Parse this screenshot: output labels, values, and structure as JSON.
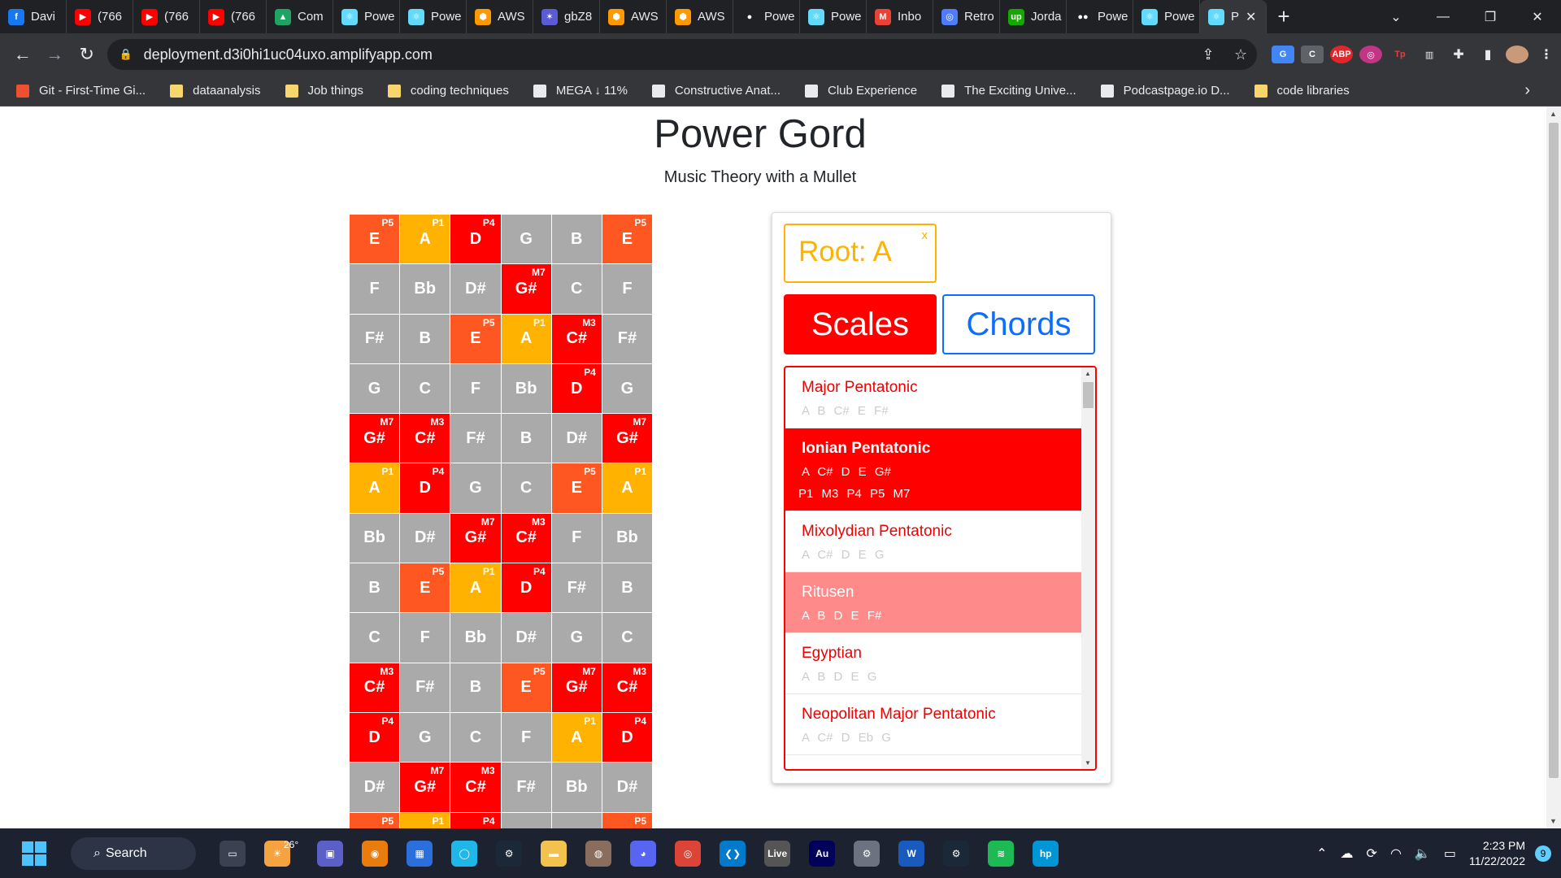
{
  "browser": {
    "tabs": [
      {
        "label": "Davi",
        "icon": "facebook-icon",
        "color": "#1877f2",
        "glyph": "f"
      },
      {
        "label": "(766",
        "icon": "youtube-icon",
        "color": "#ff0000",
        "glyph": "▶"
      },
      {
        "label": "(766",
        "icon": "youtube-icon",
        "color": "#ff0000",
        "glyph": "▶"
      },
      {
        "label": "(766",
        "icon": "youtube-icon",
        "color": "#ff0000",
        "glyph": "▶"
      },
      {
        "label": "Com",
        "icon": "google-drive-icon",
        "color": "#1fa463",
        "glyph": "▲"
      },
      {
        "label": "Powe",
        "icon": "react-icon",
        "color": "#61dafb",
        "glyph": "⚛"
      },
      {
        "label": "Powe",
        "icon": "react-icon",
        "color": "#61dafb",
        "glyph": "⚛"
      },
      {
        "label": "AWS",
        "icon": "aws-icon",
        "color": "#ff9900",
        "glyph": "⬢"
      },
      {
        "label": "gbZ8",
        "icon": "graph-icon",
        "color": "#5b5bd6",
        "glyph": "✶"
      },
      {
        "label": "AWS",
        "icon": "aws-icon",
        "color": "#ff9900",
        "glyph": "⬢"
      },
      {
        "label": "AWS",
        "icon": "aws-icon",
        "color": "#ff9900",
        "glyph": "⬢"
      },
      {
        "label": "Powe",
        "icon": "github-icon",
        "color": "#202124",
        "glyph": "●"
      },
      {
        "label": "Powe",
        "icon": "react-icon",
        "color": "#61dafb",
        "glyph": "⚛"
      },
      {
        "label": "Inbo",
        "icon": "gmail-icon",
        "color": "#ea4335",
        "glyph": "M"
      },
      {
        "label": "Retro",
        "icon": "globe-icon",
        "color": "#4f7cff",
        "glyph": "◎"
      },
      {
        "label": "Jorda",
        "icon": "upwork-icon",
        "color": "#14a800",
        "glyph": "up"
      },
      {
        "label": "Powe",
        "icon": "medium-icon",
        "color": "#202124",
        "glyph": "●●"
      },
      {
        "label": "Powe",
        "icon": "react-icon",
        "color": "#61dafb",
        "glyph": "⚛"
      },
      {
        "label": "P",
        "icon": "react-icon",
        "color": "#61dafb",
        "glyph": "⚛",
        "active": true
      }
    ],
    "url": "deployment.d3i0hi1uc04uxo.amplifyapp.com",
    "bookmarks": [
      {
        "label": "Git - First-Time Gi...",
        "color": "#f05032"
      },
      {
        "label": "dataanalysis",
        "color": "#f9d56e"
      },
      {
        "label": "Job things",
        "color": "#f9d56e"
      },
      {
        "label": "coding techniques",
        "color": "#f9d56e"
      },
      {
        "label": "MEGA ↓ 11%",
        "color": "#e8eaed"
      },
      {
        "label": "Constructive Anat...",
        "color": "#e8eaed"
      },
      {
        "label": "Club Experience",
        "color": "#e8eaed"
      },
      {
        "label": "The Exciting Unive...",
        "color": "#e8eaed"
      },
      {
        "label": "Podcastpage.io D...",
        "color": "#e8eaed"
      },
      {
        "label": "code libraries",
        "color": "#f9d56e"
      }
    ]
  },
  "app": {
    "title": "Power Gord",
    "subtitle": "Music Theory with a Mullet",
    "colors": {
      "root": "#ffb300",
      "fifth": "#ff5722",
      "scale_tone": "#ff0000",
      "other": "#aaaaaa",
      "accent": "#0d6efd"
    },
    "fretboard": [
      [
        {
          "n": "E",
          "i": "P5"
        },
        {
          "n": "A",
          "i": "P1"
        },
        {
          "n": "D",
          "i": "P4"
        },
        {
          "n": "G",
          "i": ""
        },
        {
          "n": "B",
          "i": ""
        },
        {
          "n": "E",
          "i": "P5"
        }
      ],
      [
        {
          "n": "F",
          "i": ""
        },
        {
          "n": "Bb",
          "i": ""
        },
        {
          "n": "D#",
          "i": ""
        },
        {
          "n": "G#",
          "i": "M7"
        },
        {
          "n": "C",
          "i": ""
        },
        {
          "n": "F",
          "i": ""
        }
      ],
      [
        {
          "n": "F#",
          "i": ""
        },
        {
          "n": "B",
          "i": ""
        },
        {
          "n": "E",
          "i": "P5"
        },
        {
          "n": "A",
          "i": "P1"
        },
        {
          "n": "C#",
          "i": "M3"
        },
        {
          "n": "F#",
          "i": ""
        }
      ],
      [
        {
          "n": "G",
          "i": ""
        },
        {
          "n": "C",
          "i": ""
        },
        {
          "n": "F",
          "i": ""
        },
        {
          "n": "Bb",
          "i": ""
        },
        {
          "n": "D",
          "i": "P4"
        },
        {
          "n": "G",
          "i": ""
        }
      ],
      [
        {
          "n": "G#",
          "i": "M7"
        },
        {
          "n": "C#",
          "i": "M3"
        },
        {
          "n": "F#",
          "i": ""
        },
        {
          "n": "B",
          "i": ""
        },
        {
          "n": "D#",
          "i": ""
        },
        {
          "n": "G#",
          "i": "M7"
        }
      ],
      [
        {
          "n": "A",
          "i": "P1"
        },
        {
          "n": "D",
          "i": "P4"
        },
        {
          "n": "G",
          "i": ""
        },
        {
          "n": "C",
          "i": ""
        },
        {
          "n": "E",
          "i": "P5"
        },
        {
          "n": "A",
          "i": "P1"
        }
      ],
      [
        {
          "n": "Bb",
          "i": ""
        },
        {
          "n": "D#",
          "i": ""
        },
        {
          "n": "G#",
          "i": "M7"
        },
        {
          "n": "C#",
          "i": "M3"
        },
        {
          "n": "F",
          "i": ""
        },
        {
          "n": "Bb",
          "i": ""
        }
      ],
      [
        {
          "n": "B",
          "i": ""
        },
        {
          "n": "E",
          "i": "P5"
        },
        {
          "n": "A",
          "i": "P1"
        },
        {
          "n": "D",
          "i": "P4"
        },
        {
          "n": "F#",
          "i": ""
        },
        {
          "n": "B",
          "i": ""
        }
      ],
      [
        {
          "n": "C",
          "i": ""
        },
        {
          "n": "F",
          "i": ""
        },
        {
          "n": "Bb",
          "i": ""
        },
        {
          "n": "D#",
          "i": ""
        },
        {
          "n": "G",
          "i": ""
        },
        {
          "n": "C",
          "i": ""
        }
      ],
      [
        {
          "n": "C#",
          "i": "M3"
        },
        {
          "n": "F#",
          "i": ""
        },
        {
          "n": "B",
          "i": ""
        },
        {
          "n": "E",
          "i": "P5"
        },
        {
          "n": "G#",
          "i": "M7"
        },
        {
          "n": "C#",
          "i": "M3"
        }
      ],
      [
        {
          "n": "D",
          "i": "P4"
        },
        {
          "n": "G",
          "i": ""
        },
        {
          "n": "C",
          "i": ""
        },
        {
          "n": "F",
          "i": ""
        },
        {
          "n": "A",
          "i": "P1"
        },
        {
          "n": "D",
          "i": "P4"
        }
      ],
      [
        {
          "n": "D#",
          "i": ""
        },
        {
          "n": "G#",
          "i": "M7"
        },
        {
          "n": "C#",
          "i": "M3"
        },
        {
          "n": "F#",
          "i": ""
        },
        {
          "n": "Bb",
          "i": ""
        },
        {
          "n": "D#",
          "i": ""
        }
      ],
      [
        {
          "n": "",
          "i": "P5"
        },
        {
          "n": "",
          "i": "P1"
        },
        {
          "n": "",
          "i": "P4"
        },
        {
          "n": "",
          "i": ""
        },
        {
          "n": "",
          "i": ""
        },
        {
          "n": "",
          "i": "P5"
        }
      ]
    ],
    "panel": {
      "root_label": "Root: A",
      "root_close": "x",
      "scales_label": "Scales",
      "chords_label": "Chords",
      "scales": [
        {
          "name": "Major Pentatonic",
          "notes": "A B C# E F#",
          "state": "normal"
        },
        {
          "name": "Ionian Pentatonic",
          "notes": "A C# D E G#",
          "intervals": "P1 M3 P4 P5 M7",
          "state": "selected"
        },
        {
          "name": "Mixolydian Pentatonic",
          "notes": "A C# D E G",
          "state": "normal"
        },
        {
          "name": "Ritusen",
          "notes": "A B D E F#",
          "state": "hover"
        },
        {
          "name": "Egyptian",
          "notes": "A B D E G",
          "state": "normal"
        },
        {
          "name": "Neopolitan Major Pentatonic",
          "notes": "A C# D Eb G",
          "state": "normal"
        }
      ]
    }
  },
  "taskbar": {
    "search_label": "Search",
    "weather": "26°",
    "time": "2:23 PM",
    "date": "11/22/2022",
    "badge": "9",
    "apps": [
      {
        "name": "task-view-icon",
        "color": "#3a4150",
        "glyph": "▭"
      },
      {
        "name": "weather-icon",
        "color": "#f4a340",
        "glyph": "☀"
      },
      {
        "name": "teams-icon",
        "color": "#5b5fc7",
        "glyph": "▣"
      },
      {
        "name": "blender-icon",
        "color": "#e87d0d",
        "glyph": "◉"
      },
      {
        "name": "store-icon",
        "color": "#2a6fdb",
        "glyph": "▦"
      },
      {
        "name": "alexa-icon",
        "color": "#1fb6e8",
        "glyph": "◯"
      },
      {
        "name": "steam-icon",
        "color": "#1b2838",
        "glyph": "⚙"
      },
      {
        "name": "file-explorer-icon",
        "color": "#f2c14e",
        "glyph": "▬"
      },
      {
        "name": "cookie-icon",
        "color": "#8a6d5c",
        "glyph": "◍"
      },
      {
        "name": "discord-icon",
        "color": "#5865f2",
        "glyph": "◕"
      },
      {
        "name": "chrome-icon",
        "color": "#db4437",
        "glyph": "◎"
      },
      {
        "name": "vscode-icon",
        "color": "#007acc",
        "glyph": "❮❯"
      },
      {
        "name": "live-icon",
        "color": "#555",
        "glyph": "Live"
      },
      {
        "name": "audition-icon",
        "color": "#00005b",
        "glyph": "Au"
      },
      {
        "name": "settings-icon",
        "color": "#6b7280",
        "glyph": "⚙"
      },
      {
        "name": "word-icon",
        "color": "#185abd",
        "glyph": "W"
      },
      {
        "name": "steam-icon-2",
        "color": "#1b2838",
        "glyph": "⚙"
      },
      {
        "name": "spotify-icon",
        "color": "#1db954",
        "glyph": "≋"
      },
      {
        "name": "hp-icon",
        "color": "#0096d6",
        "glyph": "hp"
      }
    ]
  }
}
